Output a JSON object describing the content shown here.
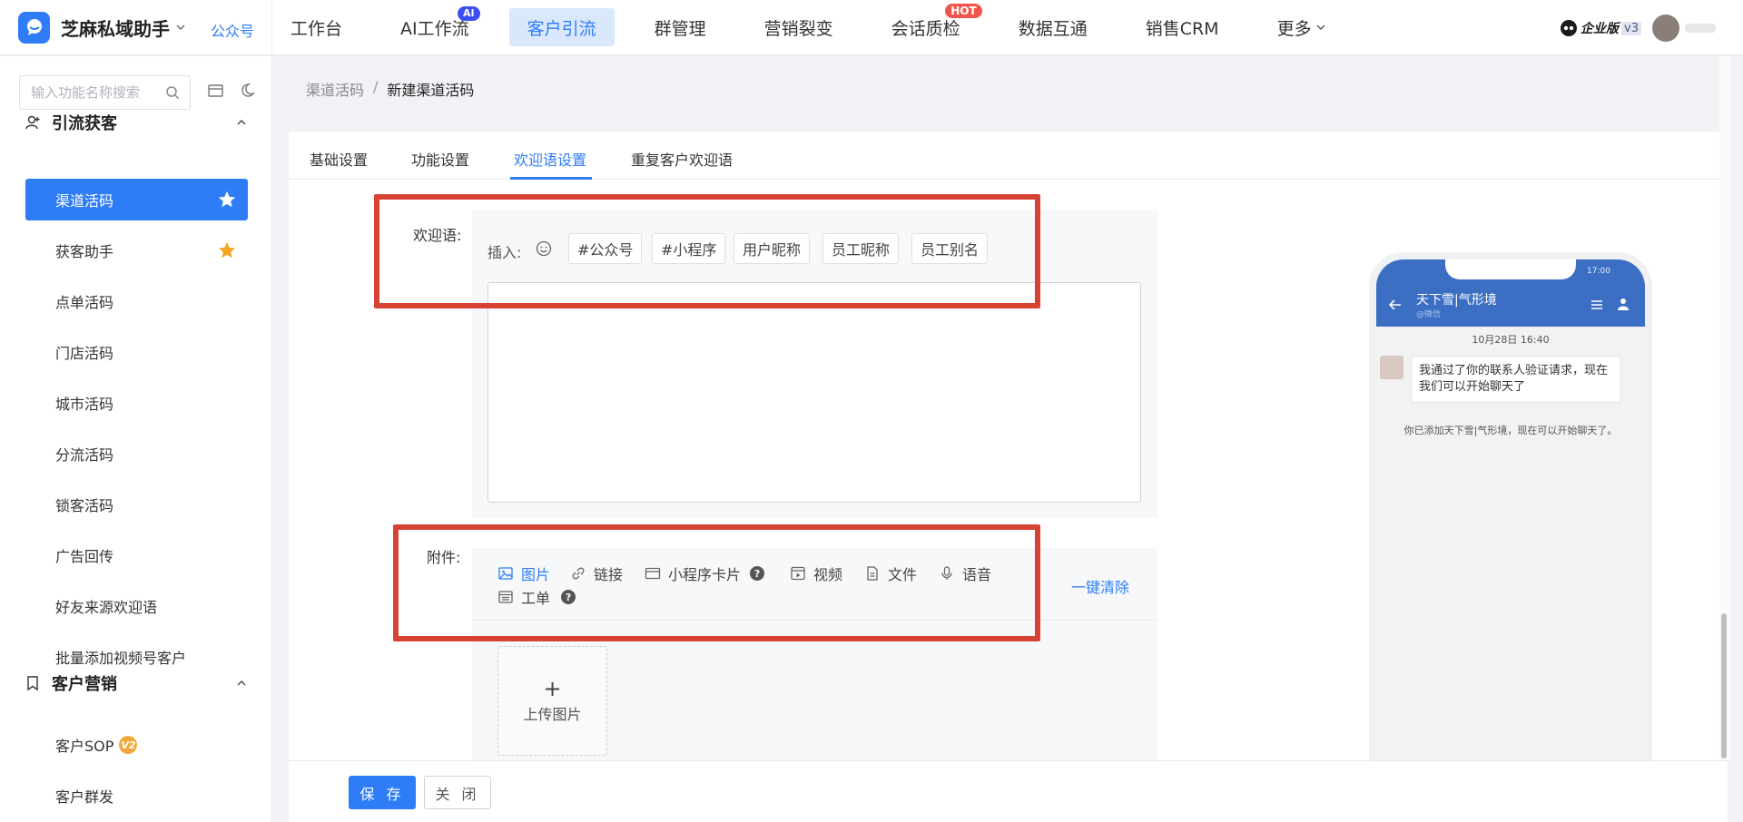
{
  "header": {
    "app_name": "芝麻私域助手",
    "account_link": "公众号",
    "nav": [
      {
        "label": "工作台"
      },
      {
        "label": "AI工作流",
        "badge": "AI"
      },
      {
        "label": "客户引流",
        "active": true
      },
      {
        "label": "群管理"
      },
      {
        "label": "营销裂变"
      },
      {
        "label": "会话质检",
        "badge": "HOT"
      },
      {
        "label": "数据互通"
      },
      {
        "label": "销售CRM"
      },
      {
        "label": "更多"
      }
    ],
    "edition": "企业版",
    "edition_version": "v3"
  },
  "sidebar": {
    "search_placeholder": "输入功能名称搜索",
    "group1": {
      "label": "引流获客"
    },
    "items": [
      {
        "label": "渠道活码",
        "active": true,
        "starred": true
      },
      {
        "label": "获客助手",
        "starred": true
      },
      {
        "label": "点单活码"
      },
      {
        "label": "门店活码"
      },
      {
        "label": "城市活码"
      },
      {
        "label": "分流活码"
      },
      {
        "label": "锁客活码"
      },
      {
        "label": "广告回传"
      },
      {
        "label": "好友来源欢迎语"
      },
      {
        "label": "批量添加视频号客户"
      }
    ],
    "group2": {
      "label": "客户营销"
    },
    "items2": [
      {
        "label": "客户SOP",
        "badge": "V2"
      },
      {
        "label": "客户群发"
      }
    ]
  },
  "breadcrumb": {
    "parent": "渠道活码",
    "sep": "/",
    "current": "新建渠道活码"
  },
  "tabs": [
    {
      "label": "基础设置"
    },
    {
      "label": "功能设置"
    },
    {
      "label": "欢迎语设置",
      "active": true
    },
    {
      "label": "重复客户欢迎语"
    }
  ],
  "greeting": {
    "label": "欢迎语:",
    "insert_label": "插入:",
    "chips": [
      "#公众号",
      "#小程序",
      "用户昵称",
      "员工昵称",
      "员工别名"
    ],
    "text": ""
  },
  "attachment": {
    "label": "附件:",
    "types": [
      "图片",
      "链接",
      "小程序卡片",
      "视频",
      "文件",
      "语音",
      "工单"
    ],
    "active_type": "图片",
    "clear_label": "一键清除",
    "upload_label": "上传图片",
    "help_symbol": "?"
  },
  "preview": {
    "status_time": "17:00",
    "chat_title": "天下雪|气形境",
    "chat_subtitle": "@微信",
    "date": "10月28日 16:40",
    "message": "我通过了你的联系人验证请求，现在我们可以开始聊天了",
    "system_message": "你已添加天下雪|气形境，现在可以开始聊天了。"
  },
  "footer": {
    "save_label": "保 存",
    "close_label": "关 闭"
  },
  "colors": {
    "accent": "#2e7df6",
    "highlight_box": "#d64334",
    "hot_badge": "#f2544b",
    "ai_badge": "#3b4ef3",
    "star": "#f5a623"
  }
}
